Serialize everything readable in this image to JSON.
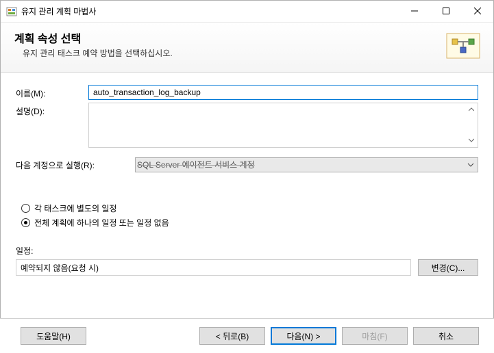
{
  "window": {
    "title": "유지 관리 계획 마법사"
  },
  "header": {
    "title": "계획 속성 선택",
    "subtitle": "유지 관리 태스크 예약 방법을 선택하십시오."
  },
  "form": {
    "name_label": "이름(M):",
    "name_value": "auto_transaction_log_backup",
    "desc_label": "설명(D):",
    "desc_value": ""
  },
  "runas": {
    "label": "다음 계정으로 실행(R):",
    "value": "SQL Server 에이전트 서비스 계정"
  },
  "radios": {
    "separate": "각 태스크에 별도의 일정",
    "single": "전체 계획에 하나의 일정 또는 일정 없음"
  },
  "schedule": {
    "label": "일정:",
    "value": "예약되지 않음(요청 시)",
    "change_btn": "변경(C)..."
  },
  "footer": {
    "help": "도움말(H)",
    "back": "< 뒤로(B)",
    "next": "다음(N) >",
    "finish": "마침(F)",
    "cancel": "취소"
  }
}
